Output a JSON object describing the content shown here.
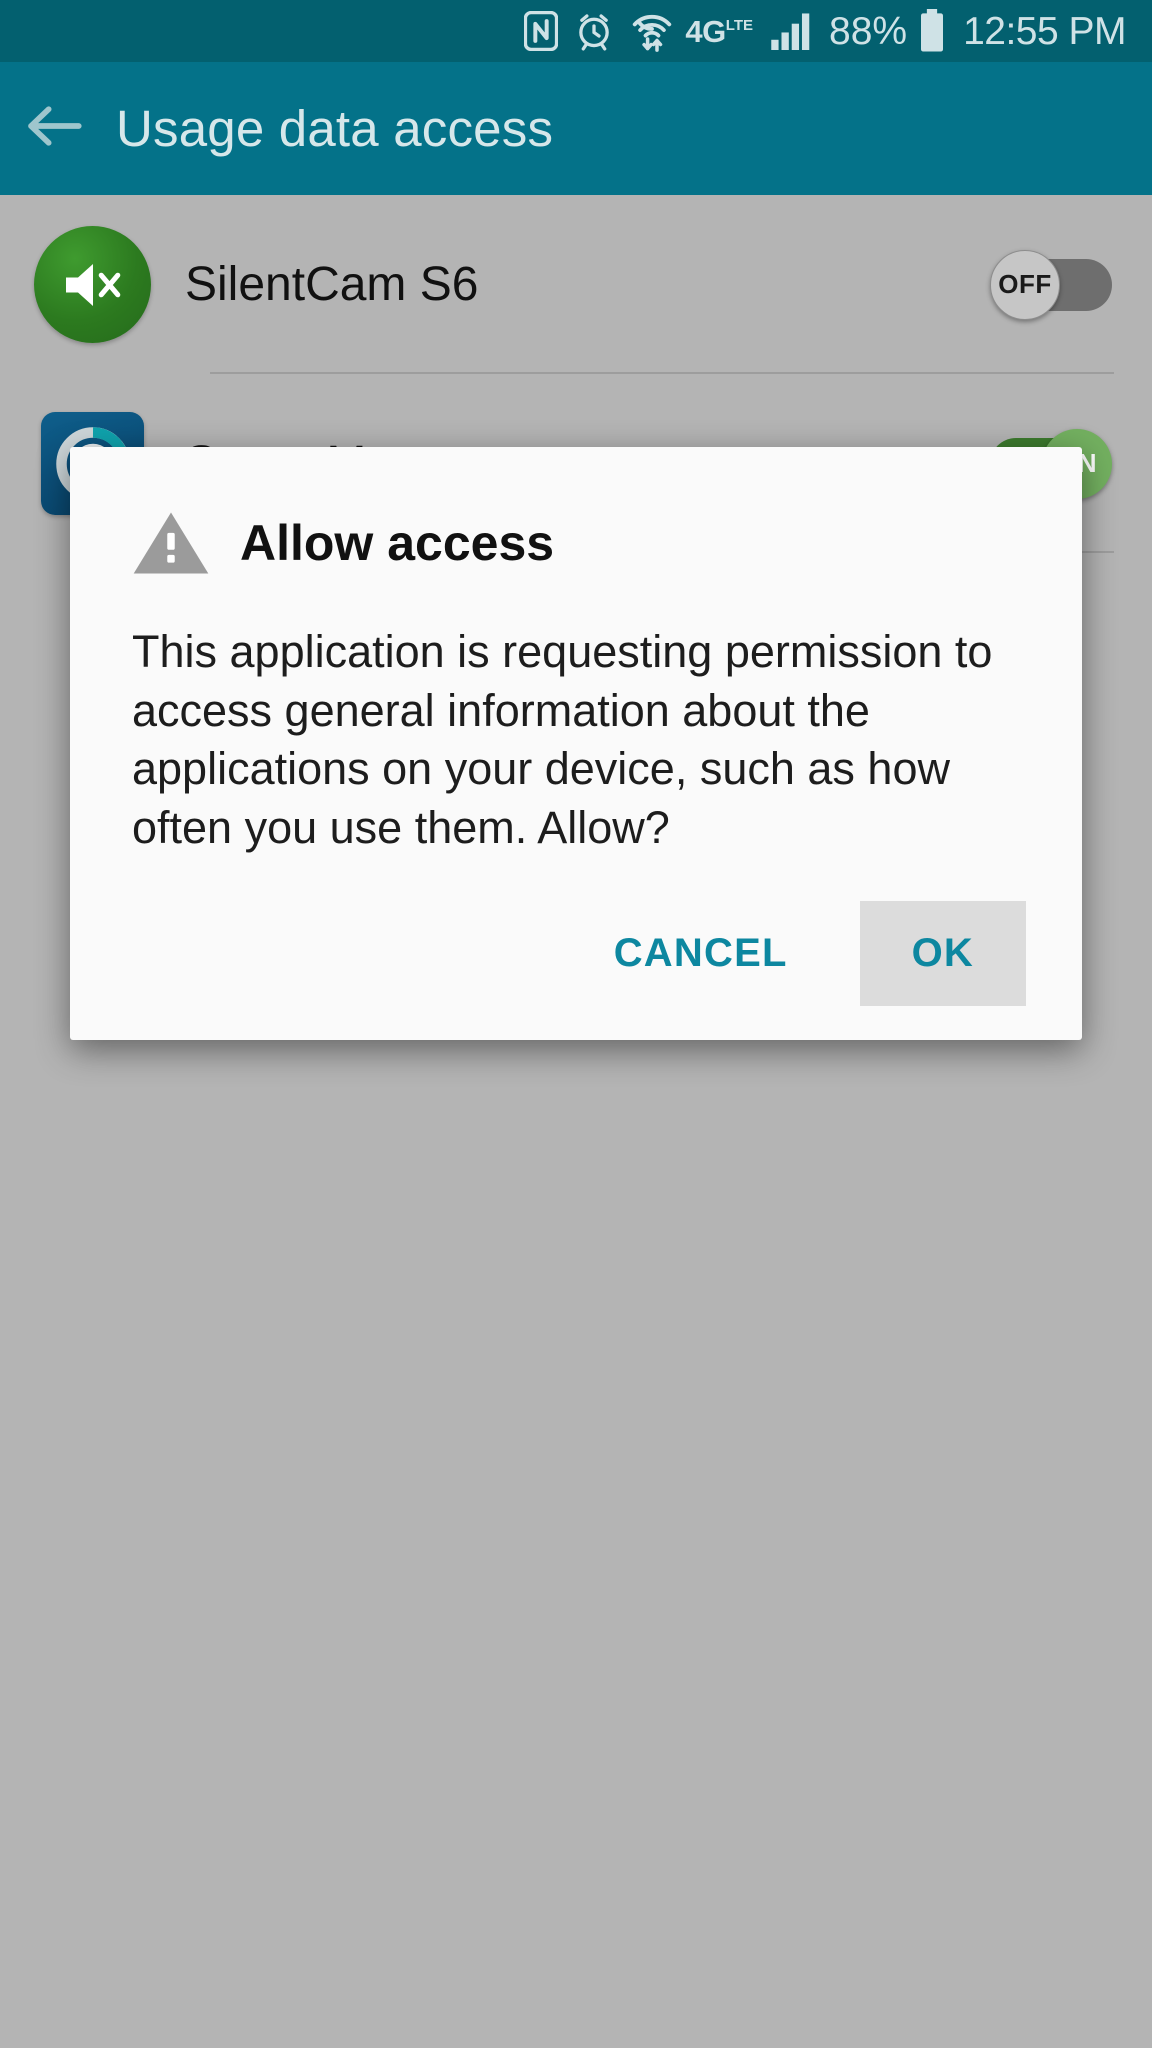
{
  "status_bar": {
    "background_color": "#03606f",
    "foreground_color": "#cfe2e6",
    "icons": [
      "nfc-icon",
      "alarm-icon",
      "wifi-transfer-icon",
      "4g-lte-icon",
      "cellular-signal-icon"
    ],
    "network_label": "4G",
    "network_sublabel": "LTE",
    "battery_percent": "88%",
    "time": "12:55 PM"
  },
  "action_bar": {
    "background_color": "#047289",
    "back_icon": "arrow-left-icon",
    "title": "Usage data access"
  },
  "list": {
    "items": [
      {
        "label": "SilentCam S6",
        "icon": "silent-speaker-icon",
        "icon_color": "#2c7a1f",
        "toggle_state": "OFF",
        "toggle_label": "OFF"
      },
      {
        "label": "Smart Manager",
        "icon": "smart-manager-icon",
        "icon_color": "#0b4f79",
        "toggle_state": "ON",
        "toggle_label": "ON"
      }
    ]
  },
  "dialog": {
    "icon": "warning-triangle-icon",
    "icon_color": "#9b9b9b",
    "title": "Allow access",
    "message": "This application is requesting permission to access general information about the applications on your device, such as how often you use them. Allow?",
    "cancel_label": "CANCEL",
    "ok_label": "OK",
    "accent_color": "#0d87a0"
  }
}
